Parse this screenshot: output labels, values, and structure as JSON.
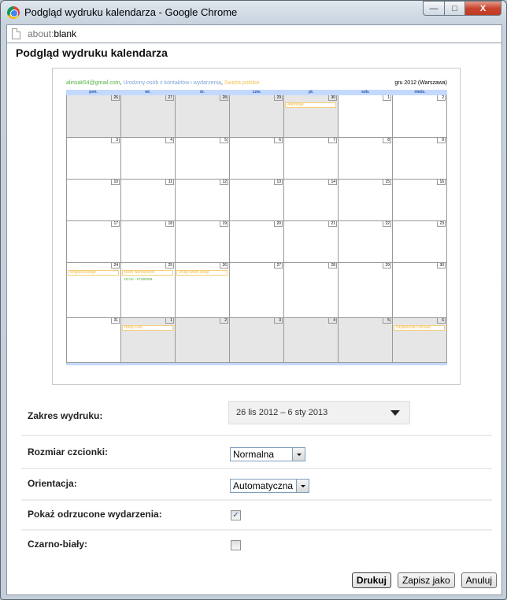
{
  "window": {
    "title": "Podgląd wydruku kalendarza - Google Chrome",
    "controls": {
      "minimize": "—",
      "maximize": "□",
      "close": "X"
    }
  },
  "addressbar": {
    "scheme": "about:",
    "path": "blank"
  },
  "page": {
    "title": "Podgląd wydruku kalendarza"
  },
  "preview": {
    "calendars": [
      {
        "name": "alinsak54@gmail.com",
        "color": "#52b340"
      },
      {
        "name": "Urodziny osób z kontaktów i wydarzenia",
        "color": "#7fa3d6"
      },
      {
        "name": "Święta polskie",
        "color": "#f4c458"
      }
    ],
    "separator": ", ",
    "month_label": "gru 2012 (Warszawa)",
    "weekdays": [
      "pon.",
      "wt.",
      "śr.",
      "czw.",
      "pt.",
      "sob.",
      "niedz."
    ],
    "weeks": [
      {
        "days": [
          {
            "num": "26",
            "other": true,
            "events": []
          },
          {
            "num": "27",
            "other": true,
            "events": []
          },
          {
            "num": "28",
            "other": true,
            "events": []
          },
          {
            "num": "29",
            "other": true,
            "events": []
          },
          {
            "num": "30",
            "other": true,
            "events": [
              {
                "title": "Andrzejki",
                "type": "allday"
              }
            ]
          },
          {
            "num": "1",
            "other": false,
            "events": []
          },
          {
            "num": "2",
            "other": false,
            "events": []
          }
        ]
      },
      {
        "days": [
          {
            "num": "3",
            "other": false,
            "events": []
          },
          {
            "num": "4",
            "other": false,
            "events": []
          },
          {
            "num": "5",
            "other": false,
            "events": []
          },
          {
            "num": "6",
            "other": false,
            "events": []
          },
          {
            "num": "7",
            "other": false,
            "events": []
          },
          {
            "num": "8",
            "other": false,
            "events": []
          },
          {
            "num": "9",
            "other": false,
            "events": []
          }
        ]
      },
      {
        "days": [
          {
            "num": "10",
            "other": false,
            "events": []
          },
          {
            "num": "11",
            "other": false,
            "events": []
          },
          {
            "num": "12",
            "other": false,
            "events": []
          },
          {
            "num": "13",
            "other": false,
            "events": []
          },
          {
            "num": "14",
            "other": false,
            "events": []
          },
          {
            "num": "15",
            "other": false,
            "events": []
          },
          {
            "num": "16",
            "other": false,
            "events": []
          }
        ]
      },
      {
        "days": [
          {
            "num": "17",
            "other": false,
            "events": []
          },
          {
            "num": "18",
            "other": false,
            "events": []
          },
          {
            "num": "19",
            "other": false,
            "events": []
          },
          {
            "num": "20",
            "other": false,
            "events": []
          },
          {
            "num": "21",
            "other": false,
            "events": []
          },
          {
            "num": "22",
            "other": false,
            "events": []
          },
          {
            "num": "23",
            "other": false,
            "events": []
          }
        ]
      },
      {
        "days": [
          {
            "num": "24",
            "other": false,
            "events": [
              {
                "title": "Wigilia Bożego",
                "type": "allday"
              }
            ]
          },
          {
            "num": "25",
            "other": false,
            "events": [
              {
                "title": "Boże Narodzenie",
                "type": "allday"
              },
              {
                "title": "18:00 - Prasowa",
                "type": "timed"
              }
            ]
          },
          {
            "num": "26",
            "other": false,
            "events": [
              {
                "title": "Drugi dzień świąt",
                "type": "allday"
              }
            ]
          },
          {
            "num": "27",
            "other": false,
            "events": []
          },
          {
            "num": "28",
            "other": false,
            "events": []
          },
          {
            "num": "29",
            "other": false,
            "events": []
          },
          {
            "num": "30",
            "other": false,
            "events": []
          }
        ]
      },
      {
        "days": [
          {
            "num": "31",
            "other": false,
            "events": []
          },
          {
            "num": "1",
            "other": true,
            "events": [
              {
                "title": "Nowy Rok",
                "type": "allday"
              }
            ]
          },
          {
            "num": "2",
            "other": true,
            "events": []
          },
          {
            "num": "3",
            "other": true,
            "events": []
          },
          {
            "num": "4",
            "other": true,
            "events": []
          },
          {
            "num": "5",
            "other": true,
            "events": []
          },
          {
            "num": "6",
            "other": true,
            "events": [
              {
                "title": "Objawienie Pańskie",
                "type": "allday"
              }
            ]
          }
        ]
      }
    ]
  },
  "form": {
    "range": {
      "label": "Zakres wydruku:",
      "value": "26 lis 2012 – 6 sty 2013"
    },
    "font_size": {
      "label": "Rozmiar czcionki:",
      "value": "Normalna"
    },
    "orientation": {
      "label": "Orientacja:",
      "value": "Automatyczna"
    },
    "show_declined": {
      "label": "Pokaż odrzucone wydarzenia:",
      "checked": true,
      "mark": "✓"
    },
    "black_white": {
      "label": "Czarno-biały:",
      "checked": false,
      "mark": ""
    }
  },
  "buttons": {
    "print": "Drukuj",
    "save_as": "Zapisz jako",
    "cancel": "Anuluj"
  }
}
